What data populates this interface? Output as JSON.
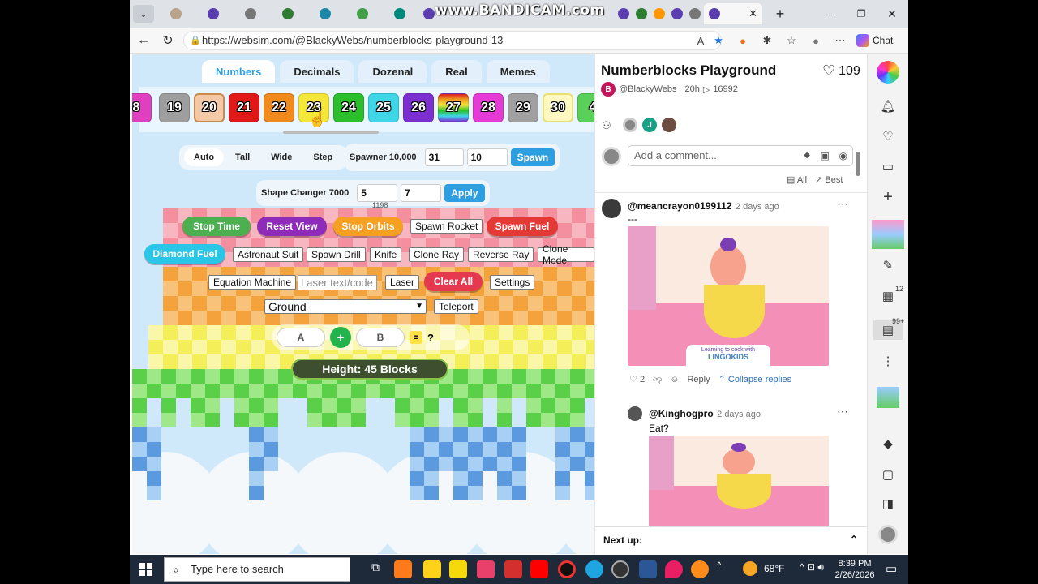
{
  "browser": {
    "watermark": "www.BANDICAM.com",
    "url": "https://websim.com/@BlackyWebs/numberblocks-playground-13",
    "chat_label": "Chat"
  },
  "game": {
    "category_tabs": [
      {
        "label": "Numbers",
        "active": true
      },
      {
        "label": "Decimals",
        "active": false
      },
      {
        "label": "Dozenal",
        "active": false
      },
      {
        "label": "Real",
        "active": false
      },
      {
        "label": "Memes",
        "active": false
      }
    ],
    "number_blocks": [
      {
        "label": "8",
        "color": "#e040c0"
      },
      {
        "label": "19",
        "color": "#9e9e9e"
      },
      {
        "label": "20",
        "color": "#f4c9a8",
        "selected": true
      },
      {
        "label": "21",
        "color": "#e01818"
      },
      {
        "label": "22",
        "color": "#f08a1c"
      },
      {
        "label": "23",
        "color": "#f5e63a",
        "hovered": true
      },
      {
        "label": "24",
        "color": "#2cbf2c"
      },
      {
        "label": "25",
        "color": "#3fd6e8"
      },
      {
        "label": "26",
        "color": "#7b2fd0"
      },
      {
        "label": "27",
        "color": "#7a1fb0"
      },
      {
        "label": "28",
        "color": "#e63ad6"
      },
      {
        "label": "29",
        "color": "#a0a0a0"
      },
      {
        "label": "30",
        "color": "#fff8c0"
      },
      {
        "label": "4",
        "color": "#5ad05a"
      }
    ],
    "modes": [
      {
        "label": "Auto",
        "active": true
      },
      {
        "label": "Tall",
        "active": false
      },
      {
        "label": "Wide",
        "active": false
      },
      {
        "label": "Step",
        "active": false
      }
    ],
    "spawner": {
      "label": "Spawner 10,000",
      "value_a": "31",
      "value_b": "10",
      "button": "Spawn"
    },
    "shape_changer": {
      "label": "Shape Changer 7000",
      "value_a": "5",
      "value_b": "7",
      "button": "Apply",
      "hint": "1198"
    },
    "pill_buttons": [
      {
        "label": "Stop Time",
        "color": "#4caf50"
      },
      {
        "label": "Reset View",
        "color": "#8e2bb8"
      },
      {
        "label": "Stop Orbits",
        "color": "#f5a020"
      },
      {
        "label": "Spawn Fuel",
        "color": "#e53935"
      },
      {
        "label": "Diamond Fuel",
        "color": "#29c6e8"
      },
      {
        "label": "Clear All",
        "color": "#e53950"
      }
    ],
    "tool_buttons": [
      "Spawn Rocket",
      "Astronaut Suit",
      "Spawn Drill",
      "Knife",
      "Clone Ray",
      "Reverse Ray",
      "Clone Mode",
      "Equation Machine",
      "Laser",
      "Settings",
      "Teleport"
    ],
    "laser_placeholder": "Laser text/code",
    "terrain_select": "Ground",
    "calculator": {
      "a": "A",
      "op": "+",
      "b": "B",
      "eq": "=",
      "result": "?"
    },
    "height_text": "Height: 45 Blocks"
  },
  "side_panel": {
    "title": "Numberblocks Playground",
    "likes": "109",
    "author": "@BlackyWebs",
    "age": "20h",
    "views": "16992",
    "comment_placeholder": "Add a comment...",
    "sort_all": "All",
    "sort_best": "Best",
    "comments": [
      {
        "user": "@meancrayon0199112",
        "time": "2 days ago",
        "text": "---",
        "likes": "2",
        "reply": "Reply",
        "collapse": "Collapse replies",
        "image_caption": "Learning to cook with",
        "image_brand": "LINGOKIDS"
      },
      {
        "user": "@Kinghogpro",
        "time": "2 days ago",
        "text": "Eat?"
      }
    ],
    "next_up": "Next up:"
  },
  "rail": {
    "badge_apps": "12",
    "badge_comments": "99+"
  },
  "taskbar": {
    "search_placeholder": "Type here to search",
    "temperature": "68°F",
    "time": "8:39 PM",
    "date": "2/26/2026"
  }
}
